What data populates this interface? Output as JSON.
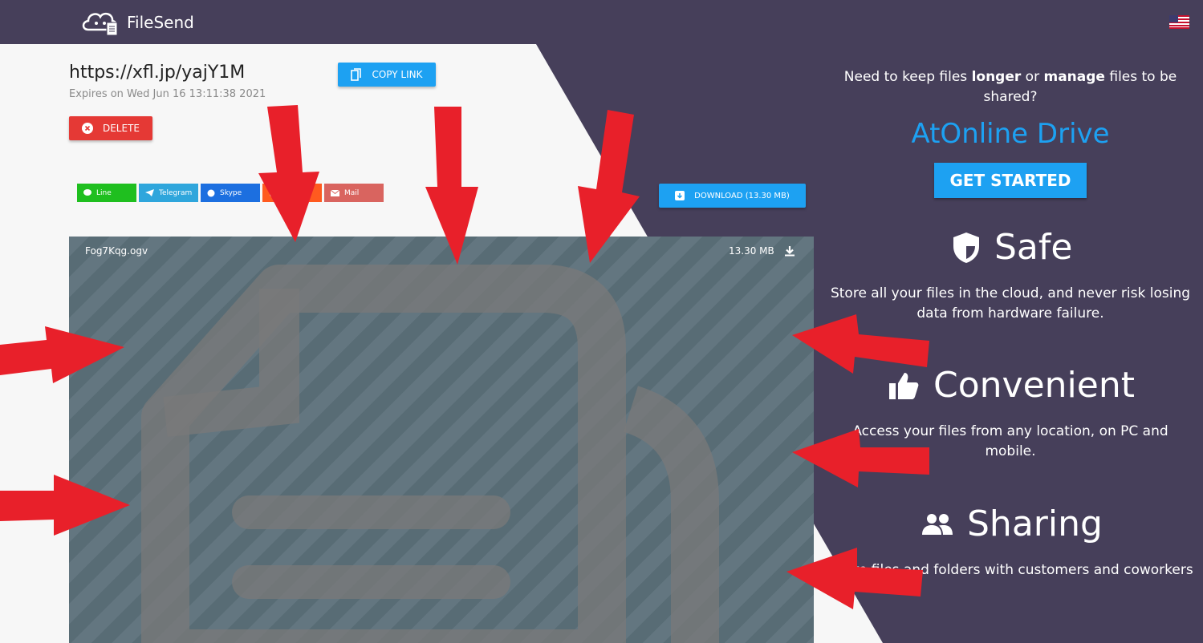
{
  "brand": {
    "name": "FileSend"
  },
  "link": {
    "url": "https://xfl.jp/yajY1M",
    "expires": "Expires on Wed Jun 16 13:11:38 2021",
    "copy_label": "COPY LINK",
    "delete_label": "DELETE"
  },
  "share_buttons": [
    {
      "label": "Line",
      "color": "#1fbf1f",
      "icon": "line-icon"
    },
    {
      "label": "Telegram",
      "color": "#2fa6dc",
      "icon": "telegram-icon"
    },
    {
      "label": "Skype",
      "color": "#1c6fe0",
      "icon": "skype-icon"
    },
    {
      "label": "",
      "color": "#ff5a1f",
      "icon": "reddit-icon"
    },
    {
      "label": "Mail",
      "color": "#d9645f",
      "icon": "mail-icon"
    }
  ],
  "download": {
    "label": "DOWNLOAD (13.30 MB)"
  },
  "file": {
    "name": "Fog7Kqg.ogv",
    "size": "13.30 MB"
  },
  "promo": {
    "question_pre": "Need to keep files ",
    "question_b1": "longer",
    "question_mid": " or ",
    "question_b2": "manage",
    "question_post": " files to be shared?",
    "title": "AtOnline Drive",
    "cta": "GET STARTED"
  },
  "features": [
    {
      "title": "Safe",
      "icon": "shield-icon",
      "text": "Store all your files in the cloud, and never risk losing data from hardware failure."
    },
    {
      "title": "Convenient",
      "icon": "thumbs-up-icon",
      "text": "Access your files from any location, on PC and mobile."
    },
    {
      "title": "Sharing",
      "icon": "people-icon",
      "text": "Share files and folders with customers and coworkers"
    }
  ],
  "colors": {
    "accent": "#1da1f2",
    "danger": "#e53935",
    "dark_bg": "#463f5a",
    "preview_bg": "#5b6f79",
    "arrow": "#e8202a"
  }
}
